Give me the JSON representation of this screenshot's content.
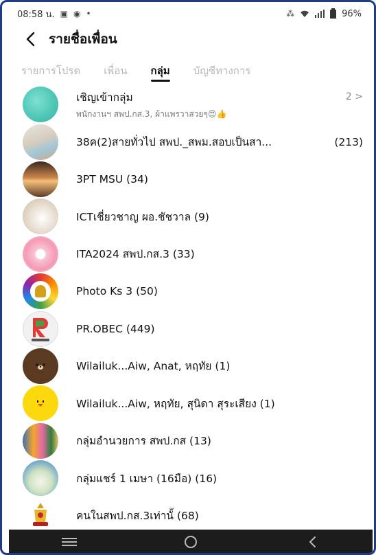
{
  "status": {
    "time": "08:58 น.",
    "battery": "96%"
  },
  "header": {
    "title": "รายชื่อเพื่อน"
  },
  "tabs": [
    {
      "label": "รายการโปรด"
    },
    {
      "label": "เพื่อน"
    },
    {
      "label": "กลุ่ม",
      "active": true
    },
    {
      "label": "บัญชีทางการ"
    }
  ],
  "invite": {
    "label": "เชิญเข้ากลุ่ม",
    "subtitle": "พนักงานฯ สพป.กส.3, ผ้าแพรวาสวยๆ😍👍",
    "count": "2 >"
  },
  "groups": [
    {
      "name": "38ค(2)สายทั่วไป สพป._สพม.สอบเป็นสา...",
      "count": "(213)"
    },
    {
      "name": "3PT MSU (34)",
      "count": ""
    },
    {
      "name": "ICTเชี่ยวชาญ ผอ.ชัชวาล (9)",
      "count": ""
    },
    {
      "name": "ITA2024 สพป.กส.3 (33)",
      "count": ""
    },
    {
      "name": "Photo Ks 3 (50)",
      "count": ""
    },
    {
      "name": "PR.OBEC (449)",
      "count": ""
    },
    {
      "name": "Wilailuk...Aiw, Anat, หฤทัย (1)",
      "count": ""
    },
    {
      "name": "Wilailuk...Aiw, หฤทัย, สุนิดา สุระเสียง (1)",
      "count": ""
    },
    {
      "name": "กลุ่มอำนวยการ สพป.กส (13)",
      "count": ""
    },
    {
      "name": "กลุ่มแชร์ 1 เมษา (16มือ) (16)",
      "count": ""
    },
    {
      "name": "คนในสพป.กส.3เท่านั้ (68)",
      "count": ""
    }
  ],
  "colors": {
    "frame": "#1e3a8a",
    "navbar": "#1c1c1c",
    "inactive_tab": "#b8b8b8"
  }
}
